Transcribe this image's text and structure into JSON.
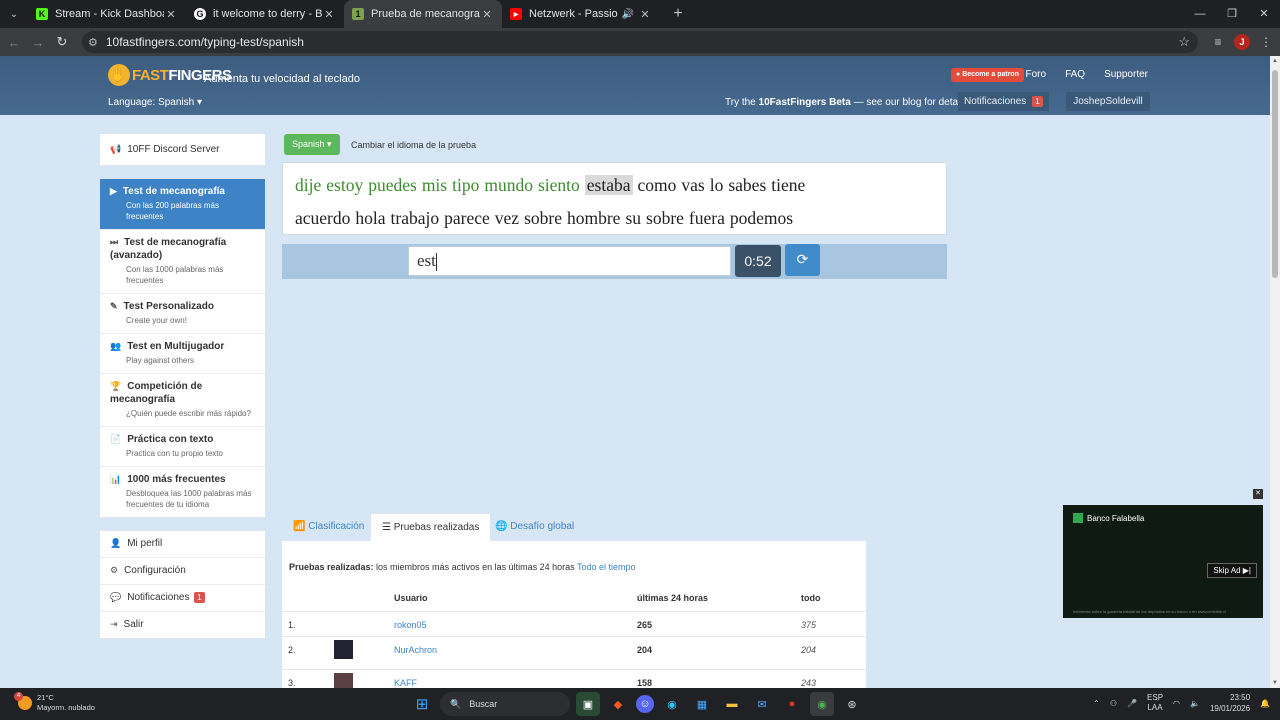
{
  "browser": {
    "tabs": [
      {
        "title": "Stream - Kick Dashboard",
        "favicon_color": "#53fc18",
        "glyph": "K"
      },
      {
        "title": "it welcome to derry - Buscar co",
        "favicon_color": "#ffffff",
        "glyph": "G"
      },
      {
        "title": "Prueba de mecanografía Spanis",
        "favicon_color": "#7da24a",
        "glyph": "1",
        "active": true
      },
      {
        "title": "Netzwerk - Passion (Extende",
        "favicon_color": "#ff0000",
        "glyph": "▶"
      }
    ],
    "url": "10fastfingers.com/typing-test/spanish",
    "profile_initial": "J"
  },
  "header": {
    "logo_fast": "FAST",
    "logo_fingers": "FINGERS",
    "tagline": "Aumenta tu velocidad al teclado",
    "patron_label": "Become a patron",
    "nav": [
      "Foro",
      "FAQ",
      "Supporter"
    ],
    "language_label": "Language: Spanish",
    "beta_prefix": "Try the ",
    "beta_name": "10FastFingers Beta",
    "beta_suffix": " — see our blog for details",
    "notifications_label": "Notificaciones",
    "notifications_count": "1",
    "username": "JoshepSoldevill"
  },
  "sidebar": {
    "discord": "10FF Discord Server",
    "items": [
      {
        "label": "Test de mecanografía",
        "sub": "Con las 200 palabras más frecuentes",
        "icon": "▶"
      },
      {
        "label": "Test de mecanografía (avanzado)",
        "sub": "Con las 1000 palabras más frecuentes",
        "icon": "⏭"
      },
      {
        "label": "Test Personalizado",
        "sub": "Create your own!",
        "icon": "✎"
      },
      {
        "label": "Test en Multijugador",
        "sub": "Play against others",
        "icon": "👥"
      },
      {
        "label": "Competición de mecanografía",
        "sub": "¿Quién puede escribir más rápido?",
        "icon": "🏆"
      },
      {
        "label": "Práctica con texto",
        "sub": "Practica con tu propio texto",
        "icon": "📄"
      },
      {
        "label": "1000 más frecuentes",
        "sub": "Desbloquea las 1000 palabras más frecuentes de tu idioma",
        "icon": "📊"
      }
    ],
    "account": [
      {
        "label": "Mi perfil",
        "icon": "👤"
      },
      {
        "label": "Configuración",
        "icon": "⚙"
      },
      {
        "label": "Notificaciones",
        "icon": "💬",
        "badge": "1"
      },
      {
        "label": "Salir",
        "icon": "⇥"
      }
    ]
  },
  "test": {
    "language_button": "Spanish",
    "change_language": "Cambiar el idioma de la prueba",
    "typed_words": [
      "dije",
      "estoy",
      "puedes",
      "mis",
      "tipo",
      "mundo",
      "siento"
    ],
    "current_word": "estaba",
    "line1_rest": [
      "como",
      "vas",
      "lo",
      "sabes",
      "tiene"
    ],
    "line2": [
      "acuerdo",
      "hola",
      "trabajo",
      "parece",
      "vez",
      "sobre",
      "hombre",
      "su",
      "sobre",
      "fuera",
      "podemos"
    ],
    "input_value": "est",
    "timer": "0:52"
  },
  "ranking": {
    "tabs": [
      "Clasificación",
      "Pruebas realizadas",
      "Desafío global"
    ],
    "intro_bold": "Pruebas realizadas:",
    "intro_text": " los miembros más activos en las últimas 24 horas ",
    "intro_link": "Todo el tiempo",
    "headers": {
      "user": "Usuario",
      "last24": "últimas 24 horas",
      "all": "todo"
    },
    "rows": [
      {
        "pos": "1.",
        "name": "rokon05",
        "last24": "265",
        "all": "375",
        "avatar": false
      },
      {
        "pos": "2.",
        "name": "NurAchron",
        "last24": "204",
        "all": "204",
        "avatar": true
      },
      {
        "pos": "3.",
        "name": "KAFF",
        "last24": "158",
        "all": "243",
        "avatar": true
      }
    ]
  },
  "ad": {
    "brand": "Banco Falabella",
    "skip": "Skip Ad ▶|",
    "fine_print": "Infórmese sobre la garantía estatal de los depósitos en su banco o en www.cmfchile.cl"
  },
  "taskbar": {
    "temp": "21°C",
    "weather": "Mayorm. nublado",
    "search": "Buscar",
    "lang_top": "ESP",
    "lang_bottom": "LAA",
    "time": "23:50",
    "date": "19/01/2026"
  }
}
